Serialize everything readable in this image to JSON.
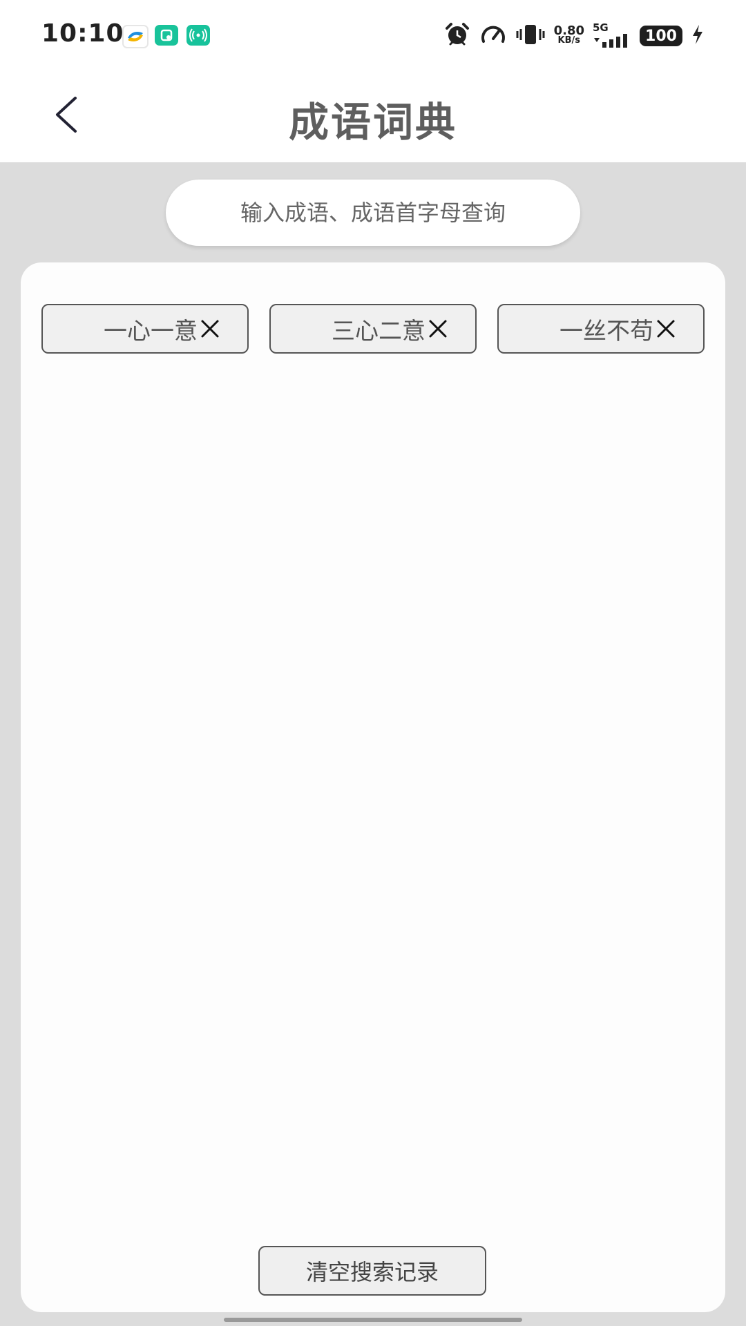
{
  "status_bar": {
    "time": "10:10",
    "net_speed_value": "0.80",
    "net_speed_unit": "KB/s",
    "network_type": "5G",
    "battery_level": "100",
    "icons": [
      "app-icon-1",
      "app-icon-2",
      "app-icon-3",
      "alarm-icon",
      "speedometer-icon",
      "vibrate-icon",
      "signal-icon",
      "battery-icon",
      "charging-icon"
    ]
  },
  "header": {
    "title": "成语词典",
    "back_icon": "chevron-left-icon"
  },
  "search": {
    "placeholder": "输入成语、成语首字母查询",
    "value": ""
  },
  "history": {
    "tags": [
      {
        "label": "一心一意"
      },
      {
        "label": "三心二意"
      },
      {
        "label": "一丝不苟"
      }
    ],
    "clear_label": "清空搜索记录"
  },
  "colors": {
    "background": "#dcdcdc",
    "card": "#fdfdfd",
    "title": "#5e5e5e",
    "accent_green": "#19c39a"
  }
}
